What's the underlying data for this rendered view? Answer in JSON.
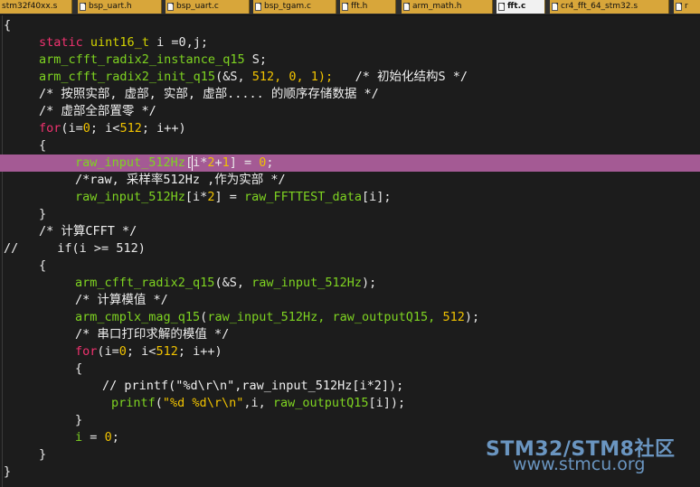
{
  "tabs": [
    {
      "label": "stm32f40xx.s",
      "active": false
    },
    {
      "label": "bsp_uart.h",
      "active": false
    },
    {
      "label": "bsp_uart.c",
      "active": false
    },
    {
      "label": "bsp_tgam.c",
      "active": false
    },
    {
      "label": "fft.h",
      "active": false
    },
    {
      "label": "arm_math.h",
      "active": false
    },
    {
      "label": "fft.c",
      "active": true
    },
    {
      "label": "cr4_fft_64_stm32.s",
      "active": false
    },
    {
      "label": "r",
      "active": false
    }
  ],
  "code": {
    "l1": "{",
    "l2_kw": "static",
    "l2_ty": "uint16_t",
    "l2_rest": "i =0,j;",
    "l3_id": "arm_cfft_radix2_instance_q15",
    "l3_rest": "S;",
    "l4_id": "arm_cfft_radix2_init_q15",
    "l4_a": "(&S,",
    "l4_n1": "512,",
    "l4_n2": "0,",
    "l4_n3": "1);",
    "l4_cm": "/* 初始化结构S */",
    "l5": "/* 按照实部, 虚部, 实部, 虚部..... 的顺序存储数据 */",
    "l6": "/* 虚部全部置零 */",
    "l7_kw": "for",
    "l7_a": "(i=",
    "l7_n1": "0",
    "l7_b": "; i<",
    "l7_n2": "512",
    "l7_c": "; i++)",
    "l8": "{",
    "l9_id1": "raw_input_512",
    "l9_id2": "Hz",
    "l9_a": "[i*",
    "l9_n1": "2",
    "l9_b": "+",
    "l9_n2": "1",
    "l9_c": "] =",
    "l9_n3": "0",
    "l9_d": ";",
    "l10": "/*raw, 采样率512Hz ,作为实部 */",
    "l11_id": "raw_input_512Hz",
    "l11_a": "[i*",
    "l11_n": "2",
    "l11_b": "] =",
    "l11_id2": "raw_FFTTEST_data",
    "l11_c": "[i];",
    "l12": "}",
    "l13": "/* 计算CFFT */",
    "l14_slash": "//",
    "l14_kw": "if",
    "l14_a": "(i >=",
    "l14_n": "512",
    "l14_b": ")",
    "l15": "{",
    "l16_id": "arm_cfft_radix2_q15",
    "l16_a": "(&S,",
    "l16_id2": "raw_input_512Hz",
    "l16_b": ");",
    "l17": "/* 计算模值 */",
    "l18_id": "arm_cmplx_mag_q15",
    "l18_a": "(",
    "l18_id2": "raw_input_512Hz,",
    "l18_id3": "raw_outputQ15,",
    "l18_n": "512",
    "l18_b": ");",
    "l19": "/* 串口打印求解的模值 */",
    "l20_kw": "for",
    "l20_a": "(i=",
    "l20_n1": "0",
    "l20_b": "; i<",
    "l20_n2": "512",
    "l20_c": "; i++)",
    "l21": "{",
    "l22_a": "// printf(\"%d\\r\\n\",raw_input_512Hz[i*2]);",
    "l23_id": "printf",
    "l23_a": "(",
    "l23_st": "\"%d %d\\r\\n\"",
    "l23_b": ",i,",
    "l23_id2": "raw_outputQ15",
    "l23_c": "[i]);",
    "l24": "}",
    "l25_id": "i",
    "l25_a": "=",
    "l25_n": "0",
    "l25_b": ";",
    "l26": "}",
    "l27": "}"
  },
  "watermark": {
    "title": "STM32/STM8社区",
    "url": "www.stmcu.org"
  },
  "colors": {
    "keyword": "#f0326f",
    "type": "#d2d200",
    "identifier": "#7ed321",
    "number": "#f0c200",
    "highlight_line": "#a45a94",
    "background": "#1c1c1c"
  }
}
